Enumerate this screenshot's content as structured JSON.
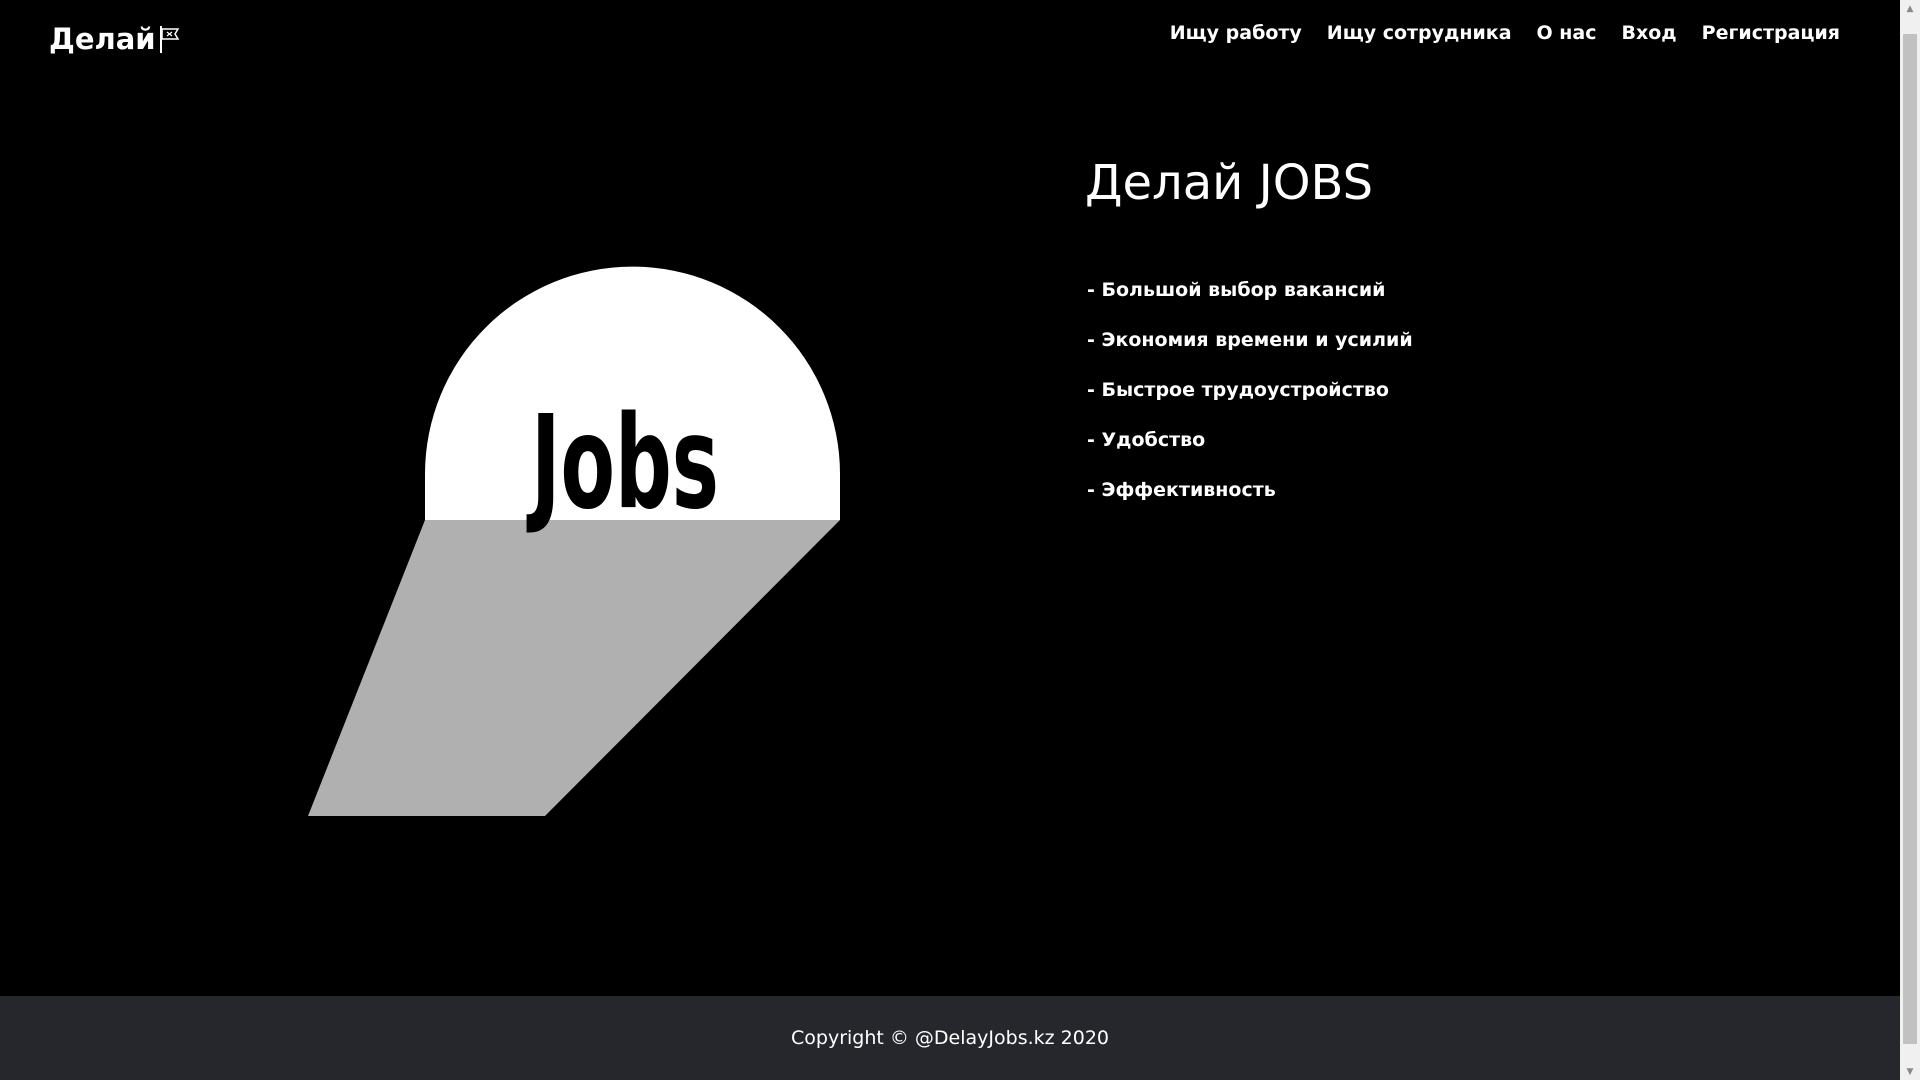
{
  "header": {
    "brand": "Делай",
    "brand_icon": "flag-icon",
    "nav": [
      {
        "label": "Ищу работу"
      },
      {
        "label": "Ищу сотрудника"
      },
      {
        "label": "О нас"
      },
      {
        "label": "Вход"
      },
      {
        "label": "Регистрация"
      }
    ]
  },
  "logo": {
    "word": "Jobs",
    "colors": {
      "dome": "#ffffff",
      "beam": "#b0b0b0",
      "text": "#000000"
    }
  },
  "hero": {
    "title": "Делай JOBS",
    "features": [
      "- Большой выбор вакансий",
      "- Экономия времени и усилий",
      "- Быстрое трудоустройство",
      "- Удобство",
      "- Эффективность"
    ]
  },
  "footer": {
    "copyright": "Copyright © @DelayJobs.kz 2020"
  },
  "scrollbar": {
    "up_icon": "scroll-up-arrow-icon",
    "down_icon": "scroll-down-arrow-icon"
  },
  "colors": {
    "background": "#000000",
    "footer_bg": "#25272c",
    "text": "#ffffff"
  }
}
